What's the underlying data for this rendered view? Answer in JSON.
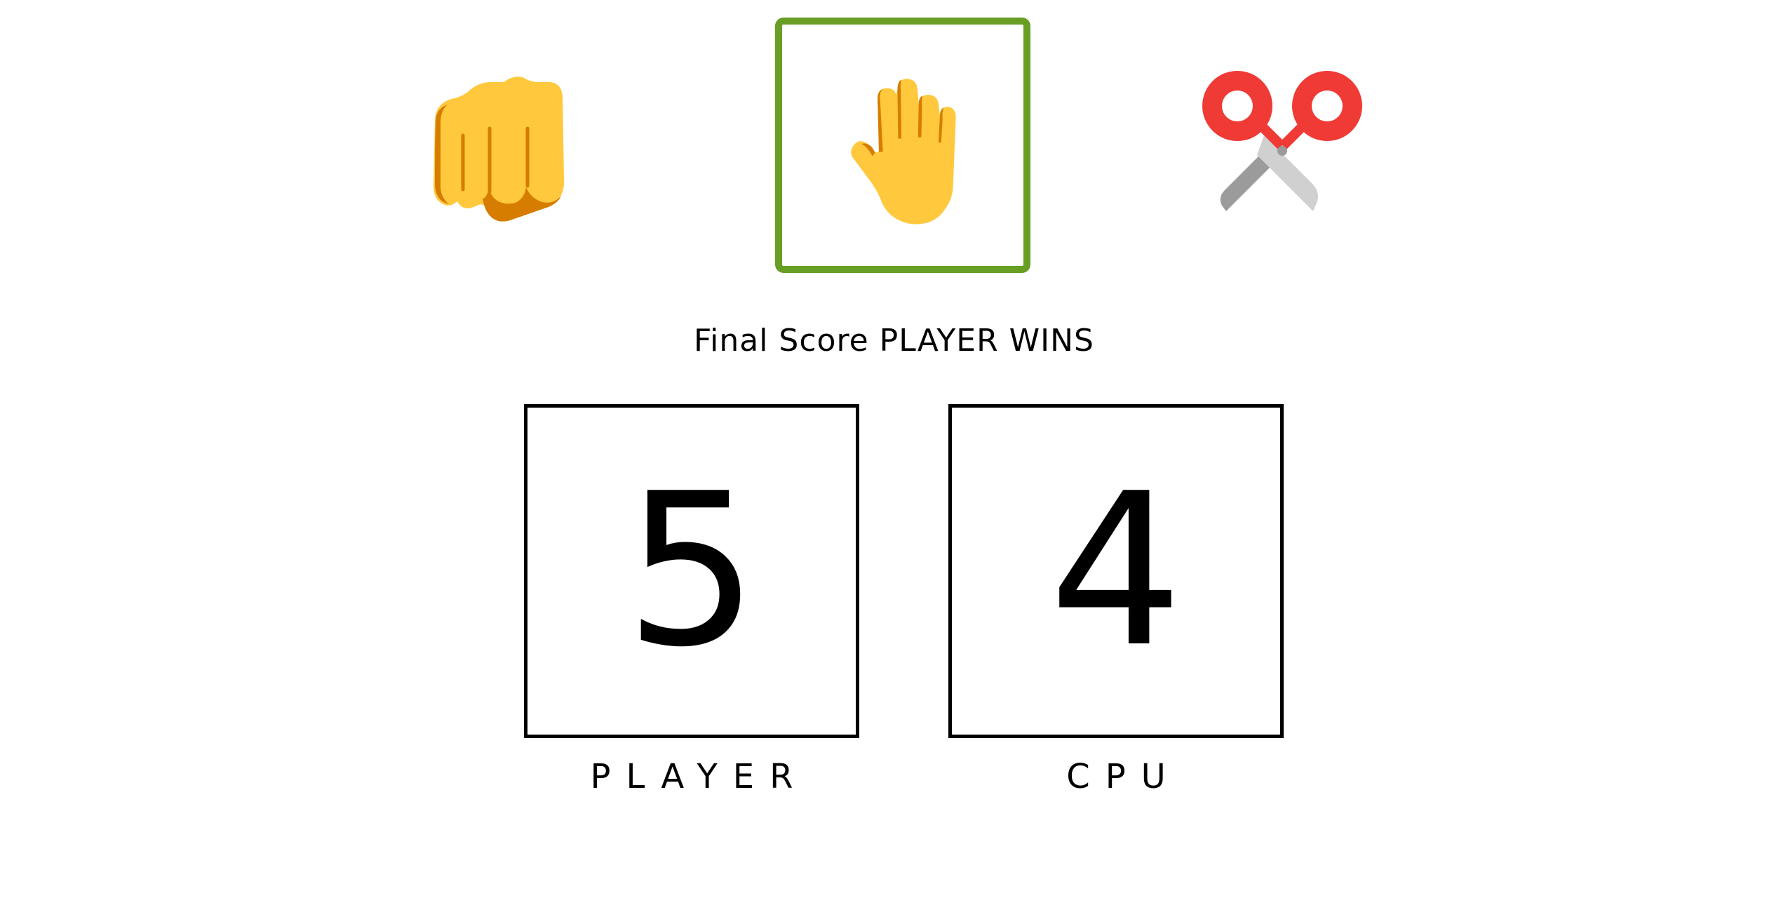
{
  "choices": [
    {
      "name": "rock",
      "icon": "fist-icon",
      "selected": false
    },
    {
      "name": "paper",
      "icon": "raised-hand-icon",
      "selected": true
    },
    {
      "name": "scissors",
      "icon": "scissors-icon",
      "selected": false
    }
  ],
  "selection_color": "#679e23",
  "result": {
    "prefix": "Final Score",
    "outcome": "PLAYER WINS"
  },
  "scores": {
    "player": {
      "value": "5",
      "label": "PLAYER"
    },
    "cpu": {
      "value": "4",
      "label": "CPU"
    }
  },
  "colors": {
    "hand_skin": "#ffc83d",
    "hand_shadow": "#d67d00",
    "scissors_handle": "#f03a35",
    "scissors_blade_dark": "#9b9b9b",
    "scissors_blade_light": "#d0d0d0"
  }
}
